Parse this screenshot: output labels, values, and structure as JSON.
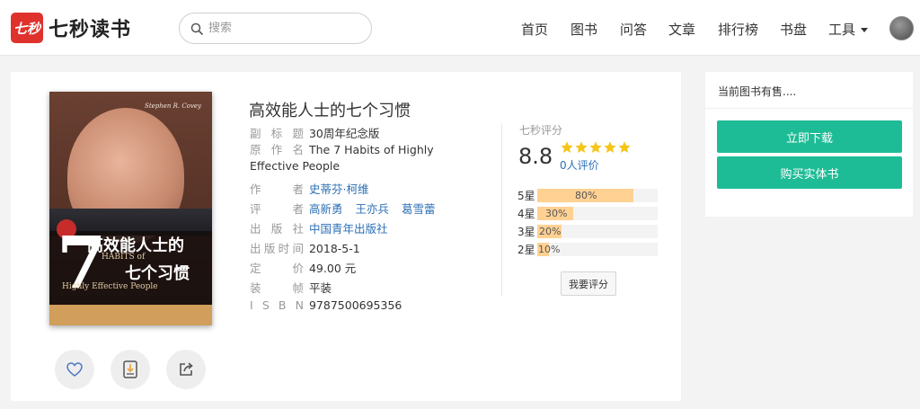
{
  "header": {
    "logo_mark": "七秒",
    "logo_text": "七秒读书",
    "search_placeholder": "搜索",
    "nav": [
      "首页",
      "图书",
      "问答",
      "文章",
      "排行榜",
      "书盘",
      "工具"
    ]
  },
  "book": {
    "title": "高效能人士的七个习惯",
    "cover": {
      "author_en": "Stephen R. Covey",
      "title_cn_1": "高效能人士的",
      "title_cn_2": "七个习惯",
      "number": "7",
      "title_en_1": "HABITS of",
      "title_en_2": "Highly Effective People"
    },
    "meta": [
      {
        "label": "副 标 题",
        "value": "30周年纪念版"
      },
      {
        "label": "原 作 名",
        "value": "The 7 Habits of Highly Effective People"
      },
      {
        "label": "作　　者",
        "links": [
          "史蒂芬·柯维"
        ]
      },
      {
        "label": "评　　者",
        "links": [
          "高新勇",
          "王亦兵",
          "葛雪蕾"
        ]
      },
      {
        "label": "出 版 社",
        "links": [
          "中国青年出版社"
        ]
      },
      {
        "label": "出版时间",
        "value": "2018-5-1"
      },
      {
        "label": "定　　价",
        "value": "49.00 元"
      },
      {
        "label": "装　　帧",
        "value": "平装"
      },
      {
        "label": "I S B N",
        "value": "9787500695356"
      }
    ]
  },
  "rating": {
    "title": "七秒评分",
    "score": "8.8",
    "stars": 5,
    "star_color": "#f5c518",
    "count_text": "0人评价",
    "distribution": [
      {
        "label": "5星",
        "pct_text": "80%",
        "fraction": 0.8
      },
      {
        "label": "4星",
        "pct_text": "30%",
        "fraction": 0.3
      },
      {
        "label": "3星",
        "pct_text": "20%",
        "fraction": 0.2
      },
      {
        "label": "2星",
        "pct_text": "10%",
        "fraction": 0.1
      }
    ],
    "rate_button": "我要评分"
  },
  "actions": [
    "heart-icon",
    "download-book-icon",
    "share-icon"
  ],
  "side": {
    "title": "当前图书有售....",
    "download_button": "立即下载",
    "buy_button": "购买实体书",
    "accent_color": "#1ebc96"
  }
}
